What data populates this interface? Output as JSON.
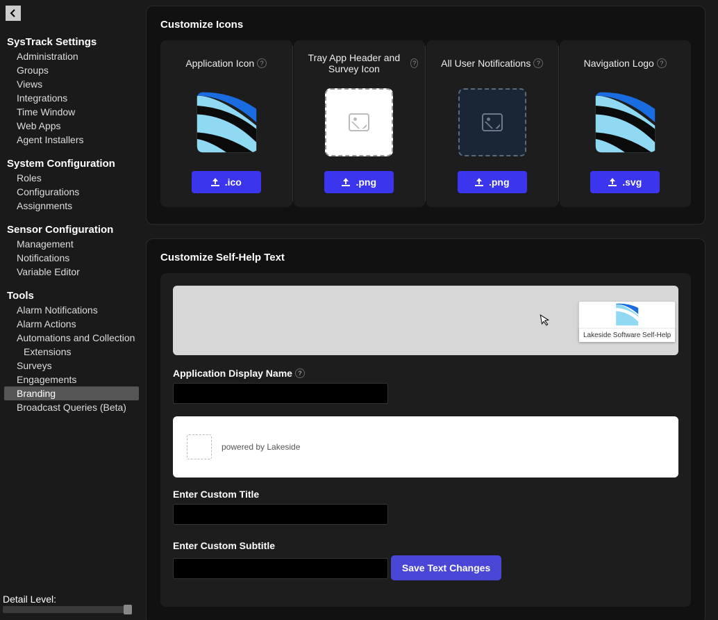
{
  "sidebar": {
    "sections": [
      {
        "title": "SysTrack Settings",
        "items": [
          "Administration",
          "Groups",
          "Views",
          "Integrations",
          "Time Window",
          "Web Apps",
          "Agent Installers"
        ]
      },
      {
        "title": "System Configuration",
        "items": [
          "Roles",
          "Configurations",
          "Assignments"
        ]
      },
      {
        "title": "Sensor Configuration",
        "items": [
          "Management",
          "Notifications",
          "Variable Editor"
        ]
      },
      {
        "title": "Tools",
        "items": [
          "Alarm Notifications",
          "Alarm Actions",
          "Automations and Collection",
          "Extensions",
          "Surveys",
          "Engagements",
          "Branding",
          "Broadcast Queries (Beta)"
        ]
      }
    ],
    "active": "Branding",
    "detail_label": "Detail Level:"
  },
  "icons_panel": {
    "title": "Customize Icons",
    "cards": [
      {
        "title": "Application Icon",
        "btn": ".ico"
      },
      {
        "title": "Tray App Header and Survey Icon",
        "btn": ".png"
      },
      {
        "title": "All User Notifications",
        "btn": ".png"
      },
      {
        "title": "Navigation Logo",
        "btn": ".svg"
      }
    ]
  },
  "selfhelp_panel": {
    "title": "Customize Self-Help Text",
    "tray_tooltip": "Lakeside Software Self-Help",
    "app_display_label": "Application Display Name",
    "app_display_value": "",
    "powered_by": "powered by Lakeside",
    "custom_title_label": "Enter Custom Title",
    "custom_title_value": "",
    "custom_subtitle_label": "Enter Custom Subtitle",
    "custom_subtitle_value": "",
    "save_btn": "Save Text Changes"
  }
}
